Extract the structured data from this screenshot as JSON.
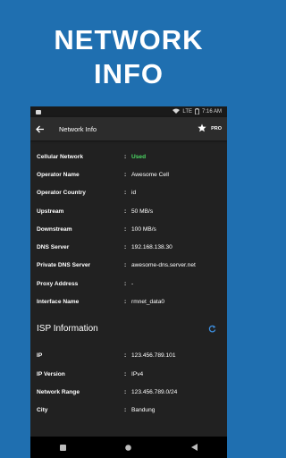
{
  "banner": {
    "line1": "NETWORK",
    "line2": "INFO"
  },
  "statusbar": {
    "network": "LTE",
    "time": "7:16 AM"
  },
  "appbar": {
    "title": "Network Info",
    "pro_label": "PRO"
  },
  "separator": ":",
  "network_rows": [
    {
      "label": "Cellular Network",
      "value": "Used"
    },
    {
      "label": "Operator Name",
      "value": "Awesome Cell"
    },
    {
      "label": "Operator Country",
      "value": "id"
    },
    {
      "label": "Upstream",
      "value": "50 MB/s"
    },
    {
      "label": "Downstream",
      "value": "100 MB/s"
    },
    {
      "label": "DNS Server",
      "value": "192.168.138.30"
    },
    {
      "label": "Private DNS Server",
      "value": "awesome-dns.server.net"
    },
    {
      "label": "Proxy Address",
      "value": "-"
    },
    {
      "label": "Interface Name",
      "value": "rmnet_data0"
    }
  ],
  "isp": {
    "title": "ISP Information",
    "rows": [
      {
        "label": "IP",
        "value": "123.456.789.101"
      },
      {
        "label": "IP Version",
        "value": "IPv4"
      },
      {
        "label": "Network Range",
        "value": "123.456.789.0/24"
      },
      {
        "label": "City",
        "value": "Bandung"
      }
    ]
  },
  "colors": {
    "background": "#1f6fb0",
    "used_status": "#4cd964",
    "refresh_icon": "#3d8fe0"
  },
  "icons": [
    "back-arrow-icon",
    "star-icon",
    "refresh-icon",
    "wifi-icon",
    "battery-icon",
    "nav-recents-icon",
    "nav-home-icon",
    "nav-back-icon"
  ]
}
